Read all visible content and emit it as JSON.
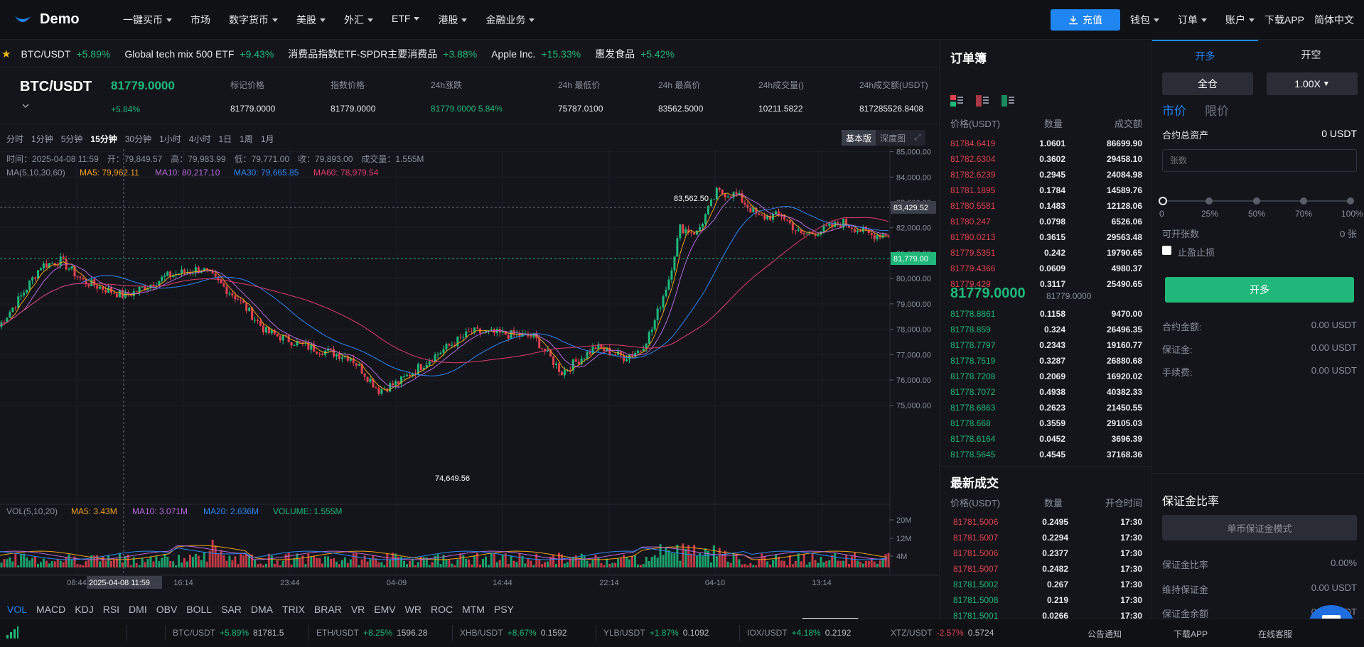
{
  "nav": {
    "brand": "Demo",
    "items": [
      "一键买币",
      "市场",
      "数字货币",
      "美股",
      "外汇",
      "ETF",
      "港股",
      "金融业务"
    ],
    "deposit": "充值",
    "right": [
      "钱包",
      "订单",
      "账户",
      "下载APP",
      "简体中文"
    ]
  },
  "ticker": [
    {
      "name": "BTC/USDT",
      "chg": "+5.89%"
    },
    {
      "name": "Global tech mix 500 ETF",
      "chg": "+9.43%"
    },
    {
      "name": "消费品指数ETF-SPDR主要消费品",
      "chg": "+3.88%"
    },
    {
      "name": "Apple Inc.",
      "chg": "+15.33%"
    },
    {
      "name": "惠发食品",
      "chg": "+5.42%"
    }
  ],
  "symbol": {
    "pair": "BTC/USDT",
    "last": "81779.0000",
    "change": "+5.84%",
    "stats": [
      {
        "label": "标记价格",
        "value": "81779.0000"
      },
      {
        "label": "指数价格",
        "value": "81779.0000"
      },
      {
        "label": "24h涨跌",
        "value": "81779.0000  5.84%"
      },
      {
        "label": "24h 最低价",
        "value": "75787.0100"
      },
      {
        "label": "24h 最高价",
        "value": "83562.5000"
      },
      {
        "label": "24h成交量()",
        "value": "10211.5822"
      },
      {
        "label": "24h成交额(USDT)",
        "value": "817285526.8408"
      }
    ]
  },
  "timeframes": [
    "分时",
    "1分钟",
    "5分钟",
    "15分钟",
    "30分钟",
    "1小时",
    "4小时",
    "1日",
    "1周",
    "1月"
  ],
  "active_timeframe": "15分钟",
  "views": [
    "基本版",
    "深度图"
  ],
  "chart_info": {
    "ohlc": "时间：2025-04-08 11:59　开：79,849.57　高：79,983.99　低：79,771.00　收：79,893.00　成交量：1.555M",
    "ma_label": "MA(5,10,30,60)",
    "ma5": "MA5: 79,962.11",
    "ma10": "MA10: 80,217.10",
    "ma30": "MA30: 79,665.85",
    "ma60": "MA60: 78,979.54",
    "vol_label": "VOL(5,10,20)",
    "vma5": "MA5: 3.43M",
    "vma10": "MA10: 3.071M",
    "vma20": "MA20: 2.636M",
    "volume": "VOLUME: 1.555M",
    "high_mark": "83,562.50",
    "low_mark": "74,649.56",
    "crosshair_price": "83,429.52",
    "last_price_tag": "81,779.00",
    "crosshair_time": "2025-04-08 11:59"
  },
  "chart_data": {
    "type": "candlestick",
    "y_ticks": [
      "85,000.00",
      "84,000.00",
      "83,000.00",
      "82,000.00",
      "81,000.00",
      "80,000.00",
      "79,000.00",
      "78,000.00",
      "77,000.00",
      "76,000.00",
      "75,000.00"
    ],
    "ylim": [
      74600,
      85100
    ],
    "vol_ticks": [
      "20M",
      "12M",
      "4M"
    ],
    "x_ticks": [
      "08:44",
      "16:14",
      "23:44",
      "04-09",
      "14:44",
      "22:14",
      "04-10",
      "13:14"
    ],
    "anchors": [
      [
        0,
        78100
      ],
      [
        8,
        79300
      ],
      [
        15,
        80500
      ],
      [
        22,
        80700
      ],
      [
        30,
        79900
      ],
      [
        45,
        79300
      ],
      [
        60,
        80100
      ],
      [
        72,
        80400
      ],
      [
        85,
        79200
      ],
      [
        95,
        77900
      ],
      [
        110,
        77300
      ],
      [
        125,
        76900
      ],
      [
        135,
        75600
      ],
      [
        142,
        75900
      ],
      [
        148,
        76400
      ],
      [
        158,
        77200
      ],
      [
        168,
        77900
      ],
      [
        180,
        77800
      ],
      [
        190,
        77700
      ],
      [
        200,
        76300
      ],
      [
        212,
        77300
      ],
      [
        222,
        76900
      ],
      [
        228,
        77200
      ],
      [
        232,
        78000
      ],
      [
        238,
        80000
      ],
      [
        242,
        82000
      ],
      [
        248,
        81800
      ],
      [
        255,
        83400
      ],
      [
        262,
        83300
      ],
      [
        270,
        82400
      ],
      [
        278,
        82500
      ],
      [
        285,
        81700
      ],
      [
        292,
        81900
      ],
      [
        300,
        82200
      ],
      [
        310,
        81700
      ],
      [
        316,
        81779
      ]
    ],
    "series": [
      {
        "name": "MA5",
        "color": "#f0a018"
      },
      {
        "name": "MA10",
        "color": "#b86ad8"
      },
      {
        "name": "MA30",
        "color": "#2f86f0"
      },
      {
        "name": "MA60",
        "color": "#e23c6e"
      }
    ]
  },
  "indicators": [
    "VOL",
    "MACD",
    "KDJ",
    "RSI",
    "DMI",
    "OBV",
    "BOLL",
    "SAR",
    "DMA",
    "TRIX",
    "BRAR",
    "VR",
    "EMV",
    "WR",
    "ROC",
    "MTM",
    "PSY"
  ],
  "orderbook": {
    "title": "订单簿",
    "headers": [
      "价格(USDT)",
      "数量",
      "成交额"
    ],
    "asks": [
      [
        "81784.6419",
        "1.0601",
        "86699.90"
      ],
      [
        "81782.6304",
        "0.3602",
        "29458.10"
      ],
      [
        "81782.6239",
        "0.2945",
        "24084.98"
      ],
      [
        "81781.1895",
        "0.1784",
        "14589.76"
      ],
      [
        "81780.5581",
        "0.1483",
        "12128.06"
      ],
      [
        "81780.247",
        "0.0798",
        "6526.06"
      ],
      [
        "81780.0213",
        "0.3615",
        "29563.48"
      ],
      [
        "81779.5351",
        "0.242",
        "19790.65"
      ],
      [
        "81779.4366",
        "0.0609",
        "4980.37"
      ],
      [
        "81779.429",
        "0.3117",
        "25490.65"
      ]
    ],
    "mid": "81779.0000",
    "mid_sub": "81779.0000",
    "bids": [
      [
        "81778.8861",
        "0.1158",
        "9470.00"
      ],
      [
        "81778.859",
        "0.324",
        "26496.35"
      ],
      [
        "81778.7797",
        "0.2343",
        "19160.77"
      ],
      [
        "81778.7519",
        "0.3287",
        "26880.68"
      ],
      [
        "81778.7208",
        "0.2069",
        "16920.02"
      ],
      [
        "81778.7072",
        "0.4938",
        "40382.33"
      ],
      [
        "81778.6863",
        "0.2623",
        "21450.55"
      ],
      [
        "81778.668",
        "0.3559",
        "29105.03"
      ],
      [
        "81778.6164",
        "0.0452",
        "3696.39"
      ],
      [
        "81778.5645",
        "0.4545",
        "37168.36"
      ]
    ]
  },
  "trades": {
    "title": "最新成交",
    "headers": [
      "价格(USDT)",
      "数量",
      "开仓时间"
    ],
    "rows": [
      [
        "81781.5006",
        "0.2495",
        "17:30",
        "dn"
      ],
      [
        "81781.5007",
        "0.2294",
        "17:30",
        "dn"
      ],
      [
        "81781.5006",
        "0.2377",
        "17:30",
        "dn"
      ],
      [
        "81781.5007",
        "0.2482",
        "17:30",
        "dn"
      ],
      [
        "81781.5002",
        "0.267",
        "17:30",
        "up"
      ],
      [
        "81781.5008",
        "0.219",
        "17:30",
        "up"
      ],
      [
        "81781.5001",
        "0.0266",
        "17:30",
        "up"
      ]
    ]
  },
  "panel": {
    "tabs": [
      "开多",
      "开空"
    ],
    "margin_mode": "全仓",
    "leverage": "1.00X",
    "order_types": [
      "市价",
      "限价"
    ],
    "total_assets_label": "合约总资产",
    "total_assets": "0 USDT",
    "qty_placeholder": "张数",
    "slider_marks": [
      "0",
      "25%",
      "50%",
      "70%",
      "100%"
    ],
    "open_label": "可开张数",
    "open_value": "0 张",
    "tpsl": "止盈止损",
    "submit": "开多",
    "rows": [
      [
        "合约金额:",
        "0.00 USDT"
      ],
      [
        "保证金:",
        "0.00 USDT"
      ],
      [
        "手续费:",
        "0.00 USDT"
      ]
    ],
    "ratio_title": "保证金比率",
    "ratio_mode": "单币保证金模式",
    "ratio_rows": [
      [
        "保证金比率",
        "0.00%"
      ],
      [
        "维持保证金",
        "0.00 USDT"
      ],
      [
        "保证金余额",
        "0.00 USDT"
      ]
    ]
  },
  "bottombar": {
    "pairs": [
      [
        "BTC/USDT",
        "+5.89%",
        "81781.5",
        "up"
      ],
      [
        "ETH/USDT",
        "+8.25%",
        "1596.28",
        "up"
      ],
      [
        "XHB/USDT",
        "+8.67%",
        "0.1592",
        "up"
      ],
      [
        "YLB/USDT",
        "+1.87%",
        "0.1092",
        "up"
      ],
      [
        "IOX/USDT",
        "+4.18%",
        "0.2192",
        "up"
      ],
      [
        "XTZ/USDT",
        "-2.57%",
        "0.5724",
        "dn"
      ]
    ],
    "links": [
      "公告通知",
      "下载APP",
      "在线客服"
    ]
  }
}
